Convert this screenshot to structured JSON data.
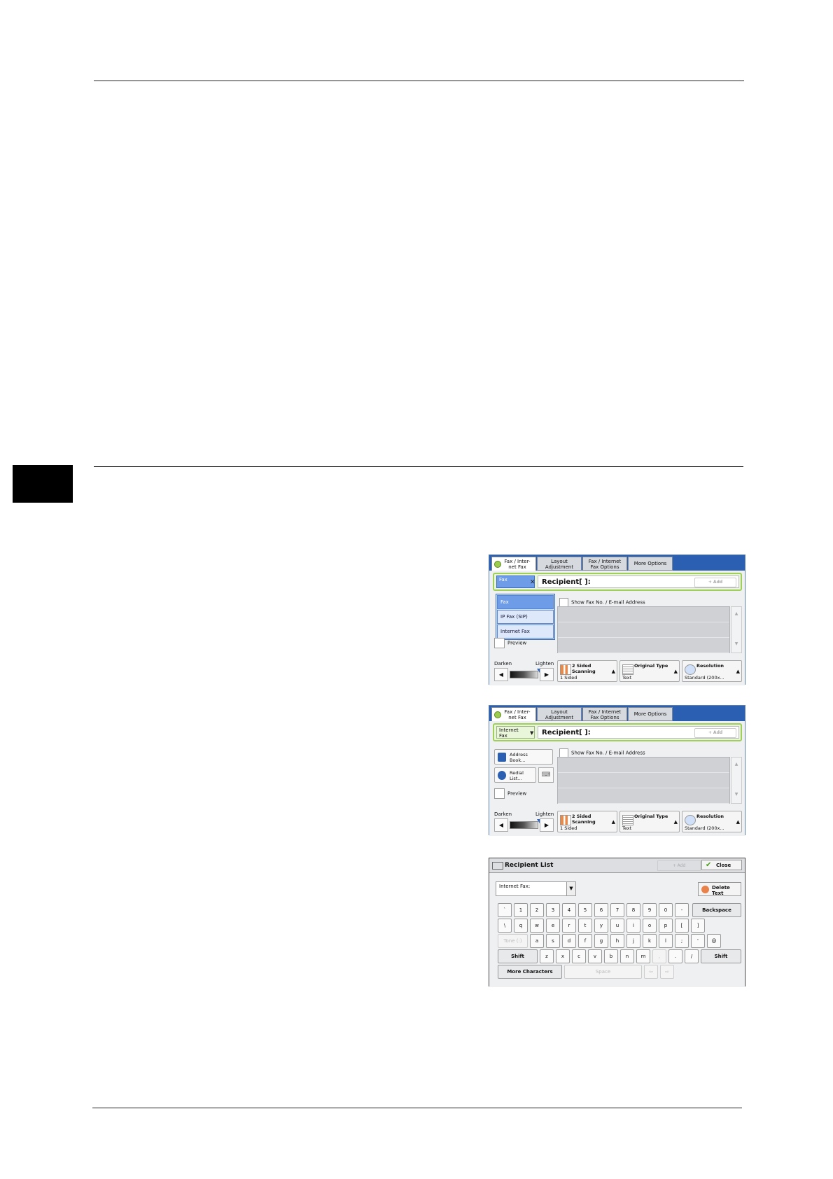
{
  "fax_screen_1": {
    "tabs": [
      "Fax / Inter-\nnet Fax",
      "Layout\nAdjustment",
      "Fax / Internet\nFax Options",
      "More Options"
    ],
    "dest_type": "Fax",
    "recipient_label": "Recipient[    ]:",
    "add_label": "+ Add",
    "dropdown_items": [
      "Fax",
      "IP Fax (SIP)",
      "Internet Fax"
    ],
    "show_address_label": "Show Fax No. / E-mail Address",
    "preview_label": "Preview",
    "darken_label": "Darken",
    "lighten_label": "Lighten",
    "buttons": [
      {
        "title": "2 Sided\nScanning",
        "value": "1 Sided",
        "icon": "two-sided-icon"
      },
      {
        "title": "Original Type",
        "value": "Text",
        "icon": "document-icon"
      },
      {
        "title": "Resolution",
        "value": "Standard (200x...",
        "icon": "magnifier-icon"
      }
    ]
  },
  "fax_screen_2": {
    "tabs": [
      "Fax / Inter-\nnet Fax",
      "Layout\nAdjustment",
      "Fax / Internet\nFax Options",
      "More Options"
    ],
    "dest_type": "Internet\nFax",
    "recipient_label": "Recipient[    ]:",
    "add_label": "+ Add",
    "address_book_label": "Address\nBook...",
    "redial_label": "Redial\nList...",
    "show_address_label": "Show Fax No. / E-mail Address",
    "preview_label": "Preview",
    "darken_label": "Darken",
    "lighten_label": "Lighten",
    "buttons": [
      {
        "title": "2 Sided\nScanning",
        "value": "1 Sided",
        "icon": "two-sided-icon"
      },
      {
        "title": "Original Type",
        "value": "Text",
        "icon": "document-icon"
      },
      {
        "title": "Resolution",
        "value": "Standard (200x...",
        "icon": "magnifier-icon"
      }
    ]
  },
  "keyboard_screen": {
    "title": "Recipient List",
    "add_label": "+ Add",
    "close_label": "Close",
    "field_value": "Internet Fax:",
    "delete_text_label": "Delete Text",
    "row1": [
      "`",
      "1",
      "2",
      "3",
      "4",
      "5",
      "6",
      "7",
      "8",
      "9",
      "0",
      "-"
    ],
    "backspace_label": "Backspace",
    "row2": [
      "\\",
      "q",
      "w",
      "e",
      "r",
      "t",
      "y",
      "u",
      "i",
      "o",
      "p",
      "[",
      "]"
    ],
    "tone_label": "Tone (:)",
    "row3": [
      "a",
      "s",
      "d",
      "f",
      "g",
      "h",
      "j",
      "k",
      "l",
      ";",
      "'",
      "@"
    ],
    "shift_label": "Shift",
    "row4": [
      "z",
      "x",
      "c",
      "v",
      "b",
      "n",
      "m",
      ",",
      ".",
      "/"
    ],
    "more_chars_label": "More Characters",
    "space_label": "Space"
  }
}
